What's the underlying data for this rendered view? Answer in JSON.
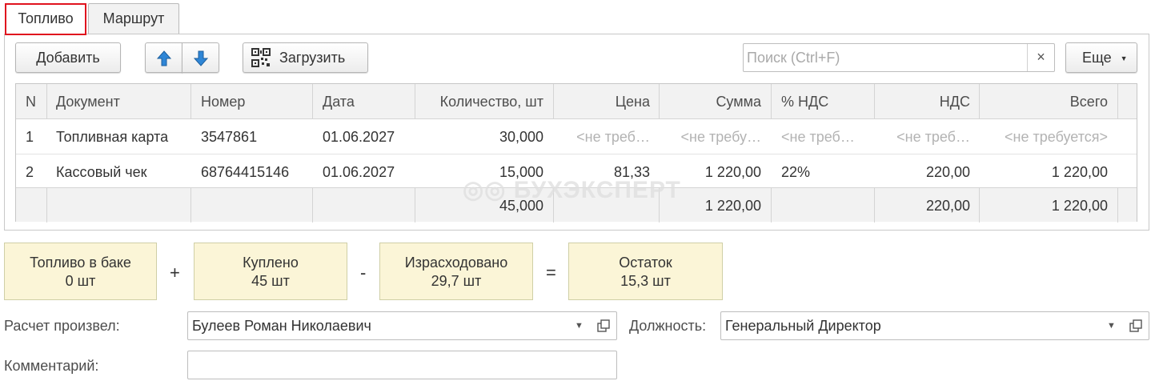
{
  "tabs": [
    {
      "label": "Топливо",
      "active": true
    },
    {
      "label": "Маршрут",
      "active": false
    }
  ],
  "toolbar": {
    "add_label": "Добавить",
    "upload_label": "Загрузить",
    "more_label": "Еще",
    "up_icon": "arrow-up-icon",
    "down_icon": "arrow-down-icon",
    "qr_icon": "qr-code-icon"
  },
  "search": {
    "placeholder": "Поиск (Ctrl+F)",
    "value": "",
    "clear": "×"
  },
  "table": {
    "columns": [
      "N",
      "Документ",
      "Номер",
      "Дата",
      "Количество, шт",
      "Цена",
      "Сумма",
      "% НДС",
      "НДС",
      "Всего"
    ],
    "rows": [
      [
        "1",
        "Топливная карта",
        "3547861",
        "01.06.2027",
        "30,000",
        "<не треб…",
        "<не требу…",
        "<не треб…",
        "<не треб…",
        "<не требуется>"
      ],
      [
        "2",
        "Кассовый чек",
        "68764415146",
        "01.06.2027",
        "15,000",
        "81,33",
        "1 220,00",
        "22%",
        "220,00",
        "1 220,00"
      ]
    ],
    "totals": [
      "",
      "",
      "",
      "",
      "45,000",
      "",
      "1 220,00",
      "",
      "220,00",
      "1 220,00"
    ]
  },
  "watermark": "БУХЭКСПЕРТ",
  "fuel": {
    "tank": {
      "title": "Топливо в баке",
      "value": "0 шт"
    },
    "bought": {
      "title": "Куплено",
      "value": "45 шт"
    },
    "spent": {
      "title": "Израсходовано",
      "value": "29,7 шт"
    },
    "rest": {
      "title": "Остаток",
      "value": "15,3 шт"
    },
    "op_plus": "+",
    "op_minus": "-",
    "op_equals": "="
  },
  "form": {
    "calc_label": "Расчет произвел:",
    "calc_value": "Булеев Роман Николаевич",
    "position_label": "Должность:",
    "position_value": "Генеральный Директор",
    "comment_label": "Комментарий:",
    "comment_value": ""
  },
  "colors": {
    "highlight": "#e0141e",
    "summary_bg": "#fbf5d7",
    "arrow_blue": "#2f86d6"
  }
}
